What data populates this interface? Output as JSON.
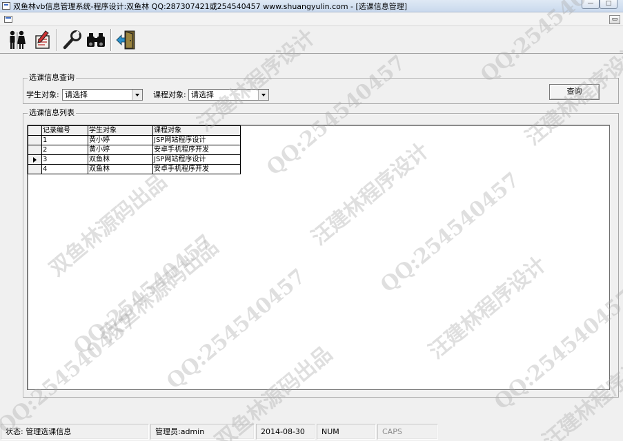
{
  "window": {
    "title": "双鱼林vb信息管理系统-程序设计:双鱼林 QQ:287307421或254540457 www.shuangyulin.com - [选课信息管理]",
    "minimize_glyph": "—",
    "maximize_glyph": "□",
    "restore_glyph": "▭"
  },
  "toolbar": {
    "buttons": [
      {
        "icon": "users-icon"
      },
      {
        "icon": "edit-document-icon"
      },
      {
        "icon": "wrench-icon"
      },
      {
        "icon": "binoculars-icon"
      },
      {
        "icon": "exit-door-icon"
      }
    ]
  },
  "query": {
    "legend": "选课信息查询",
    "student_label": "学生对象:",
    "student_value": "请选择",
    "course_label": "课程对象:",
    "course_value": "请选择",
    "button_label": "查询"
  },
  "list": {
    "legend": "选课信息列表",
    "columns": [
      "记录编号",
      "学生对象",
      "课程对象"
    ],
    "rows": [
      {
        "id": "1",
        "student": "黄小婷",
        "course": "JSP网站程序设计"
      },
      {
        "id": "2",
        "student": "黄小婷",
        "course": "安卓手机程序开发"
      },
      {
        "id": "3",
        "student": "双鱼林",
        "course": "JSP网站程序设计"
      },
      {
        "id": "4",
        "student": "双鱼林",
        "course": "安卓手机程序开发"
      }
    ],
    "selected_row": 2
  },
  "status": {
    "state": "状态: 管理选课信息",
    "user": "管理员:admin",
    "date": "2014-08-30",
    "num": "NUM",
    "caps": "CAPS"
  },
  "watermarks": {
    "qq": "QQ:254540457",
    "author": "汪建林程序设计",
    "source": "双鱼林源码出品"
  }
}
